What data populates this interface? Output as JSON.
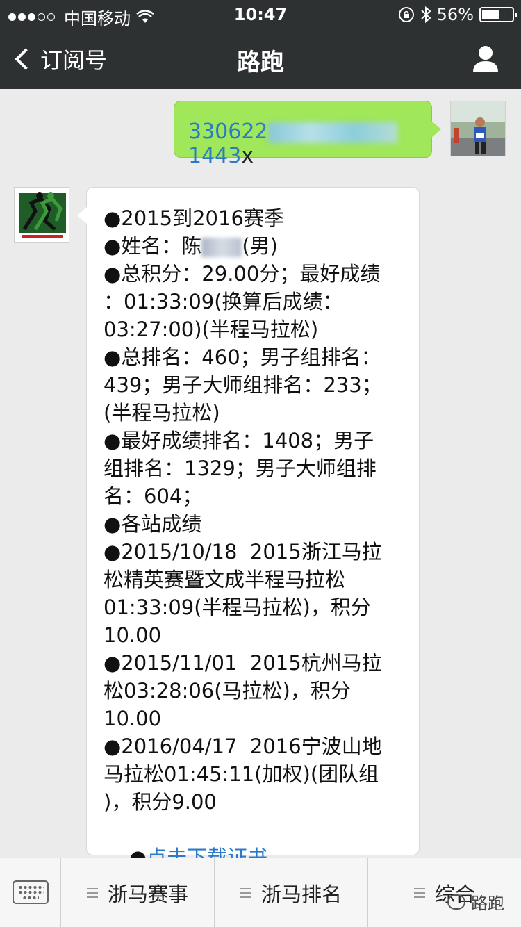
{
  "status_bar": {
    "carrier": "中国移动",
    "time": "10:47",
    "battery_percent": "56%",
    "battery_level": 0.56
  },
  "nav": {
    "back_label": "订阅号",
    "title": "路跑"
  },
  "outgoing_message": {
    "text_start": "330622",
    "text_end": "1443",
    "suffix": "x"
  },
  "incoming_message": {
    "lines": [
      "●2015到2016赛季",
      "●姓名：陈",
      "●总积分：29.00分；最好成绩",
      "：01:33:09(换算后成绩：",
      "03:27:00)(半程马拉松)",
      "●总排名：460；男子组排名：",
      "439；男子大师组排名：233；",
      "(半程马拉松)",
      "●最好成绩排名：1408；男子",
      "组排名：1329；男子大师组排",
      "名：604；",
      "●各站成绩",
      "●2015/10/18  2015浙江马拉",
      "松精英赛暨文成半程马拉松",
      "01:33:09(半程马拉松)，积分",
      "10.00",
      "●2015/11/01  2015杭州马拉",
      "松03:28:06(马拉松)，积分",
      "10.00",
      "●2016/04/17  2016宁波山地",
      "马拉松01:45:11(加权)(团队组",
      ")，积分9.00"
    ],
    "name_suffix": "(男)",
    "link_bullet": "●",
    "link_text": "点击下载证书"
  },
  "bottom_menu": {
    "items": [
      "浙马赛事",
      "浙马排名",
      "综合"
    ]
  },
  "watermark": "路跑",
  "colors": {
    "bar_dark": "#2e3132",
    "bubble_green": "#a0e75a",
    "link_blue": "#2b79c9"
  }
}
